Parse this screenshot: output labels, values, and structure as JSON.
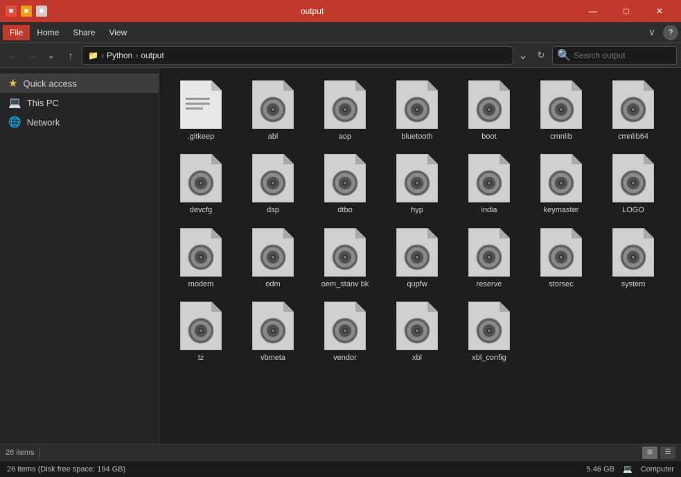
{
  "titleBar": {
    "title": "output",
    "minimize": "—",
    "maximize": "□",
    "close": "✕"
  },
  "menuBar": {
    "items": [
      "File",
      "Home",
      "Share",
      "View"
    ],
    "expandLabel": "∨",
    "helpLabel": "?"
  },
  "addressBar": {
    "back": "←",
    "forward": "→",
    "up_history": "⌄",
    "up": "↑",
    "pathIcon": "📁",
    "path": [
      "Python",
      "output"
    ],
    "refresh": "↻",
    "searchPlaceholder": "Search output"
  },
  "sidebar": {
    "items": [
      {
        "id": "quick-access",
        "label": "Quick access",
        "icon": "★",
        "iconType": "yellow"
      },
      {
        "id": "this-pc",
        "label": "This PC",
        "icon": "💻",
        "iconType": "blue"
      },
      {
        "id": "network",
        "label": "Network",
        "icon": "🌐",
        "iconType": "blue"
      }
    ]
  },
  "files": [
    {
      "id": "gitkeep",
      "name": ".gitkeep"
    },
    {
      "id": "abl",
      "name": "abl"
    },
    {
      "id": "aop",
      "name": "aop"
    },
    {
      "id": "bluetooth",
      "name": "bluetooth"
    },
    {
      "id": "boot",
      "name": "boot"
    },
    {
      "id": "cmnlib",
      "name": "cmnlib"
    },
    {
      "id": "cmnlib64",
      "name": "cmnlib64"
    },
    {
      "id": "devcfg",
      "name": "devcfg"
    },
    {
      "id": "dsp",
      "name": "dsp"
    },
    {
      "id": "dtbo",
      "name": "dtbo"
    },
    {
      "id": "hyp",
      "name": "hyp"
    },
    {
      "id": "india",
      "name": "india"
    },
    {
      "id": "keymaster",
      "name": "keymaster"
    },
    {
      "id": "LOGO",
      "name": "LOGO"
    },
    {
      "id": "modem",
      "name": "modem"
    },
    {
      "id": "odm",
      "name": "odm"
    },
    {
      "id": "oem_stanvbk",
      "name": "oem_stanv\nbk"
    },
    {
      "id": "qupfw",
      "name": "qupfw"
    },
    {
      "id": "reserve",
      "name": "reserve"
    },
    {
      "id": "storsec",
      "name": "storsec"
    },
    {
      "id": "system",
      "name": "system"
    },
    {
      "id": "tz",
      "name": "tz"
    },
    {
      "id": "vbmeta",
      "name": "vbmeta"
    },
    {
      "id": "vendor",
      "name": "vendor"
    },
    {
      "id": "xbl",
      "name": "xbl"
    },
    {
      "id": "xbl_config",
      "name": "xbl_config"
    }
  ],
  "statusBar": {
    "count": "26 items",
    "viewGrid": "⊞",
    "viewList": "☰"
  },
  "bottomBar": {
    "label": "26 items (Disk free space: 194 GB)",
    "size": "5.46 GB",
    "location": "Computer"
  }
}
